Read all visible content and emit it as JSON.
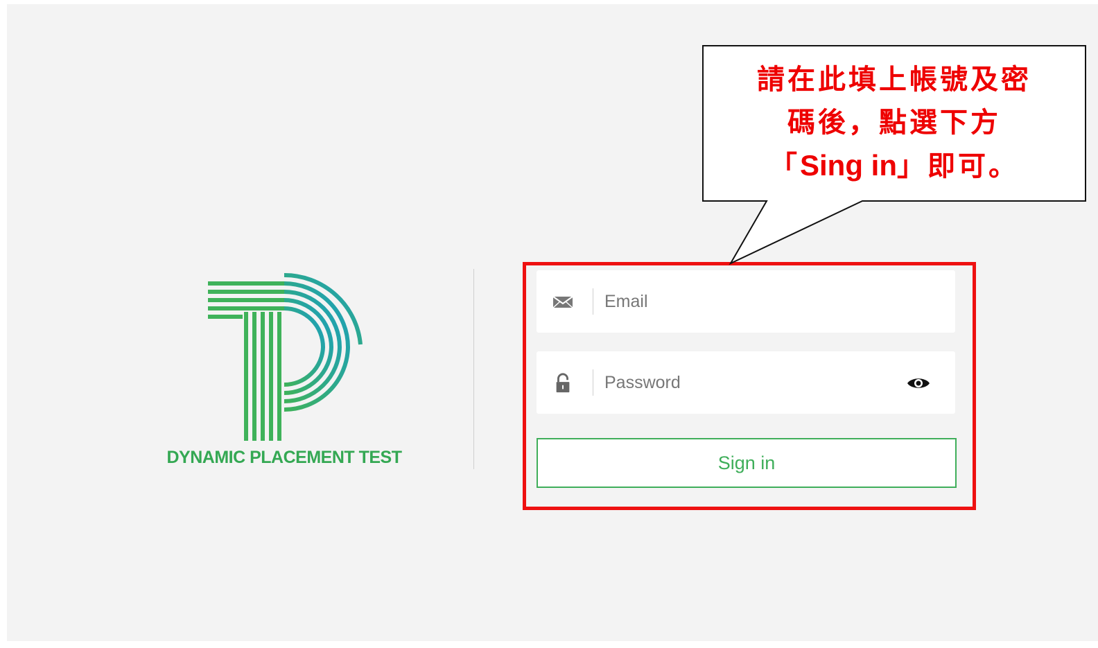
{
  "brand": {
    "logo_text": "DYNAMIC PLACEMENT TEST",
    "green": "#34a853",
    "teal": "#1fa3b5"
  },
  "login": {
    "email_placeholder": "Email",
    "password_placeholder": "Password",
    "signin_label": "Sign in",
    "email_icon": "envelope-icon",
    "password_icon": "padlock-icon",
    "toggle_icon": "eye-icon"
  },
  "callout": {
    "line1": "請在此填上帳號及密",
    "line2": "碼後，點選下方",
    "line3_open": "「",
    "line3_emph": "Sing in",
    "line3_close": "」即可。",
    "color": "#ee0000"
  },
  "highlight": {
    "color": "#ee1111"
  }
}
